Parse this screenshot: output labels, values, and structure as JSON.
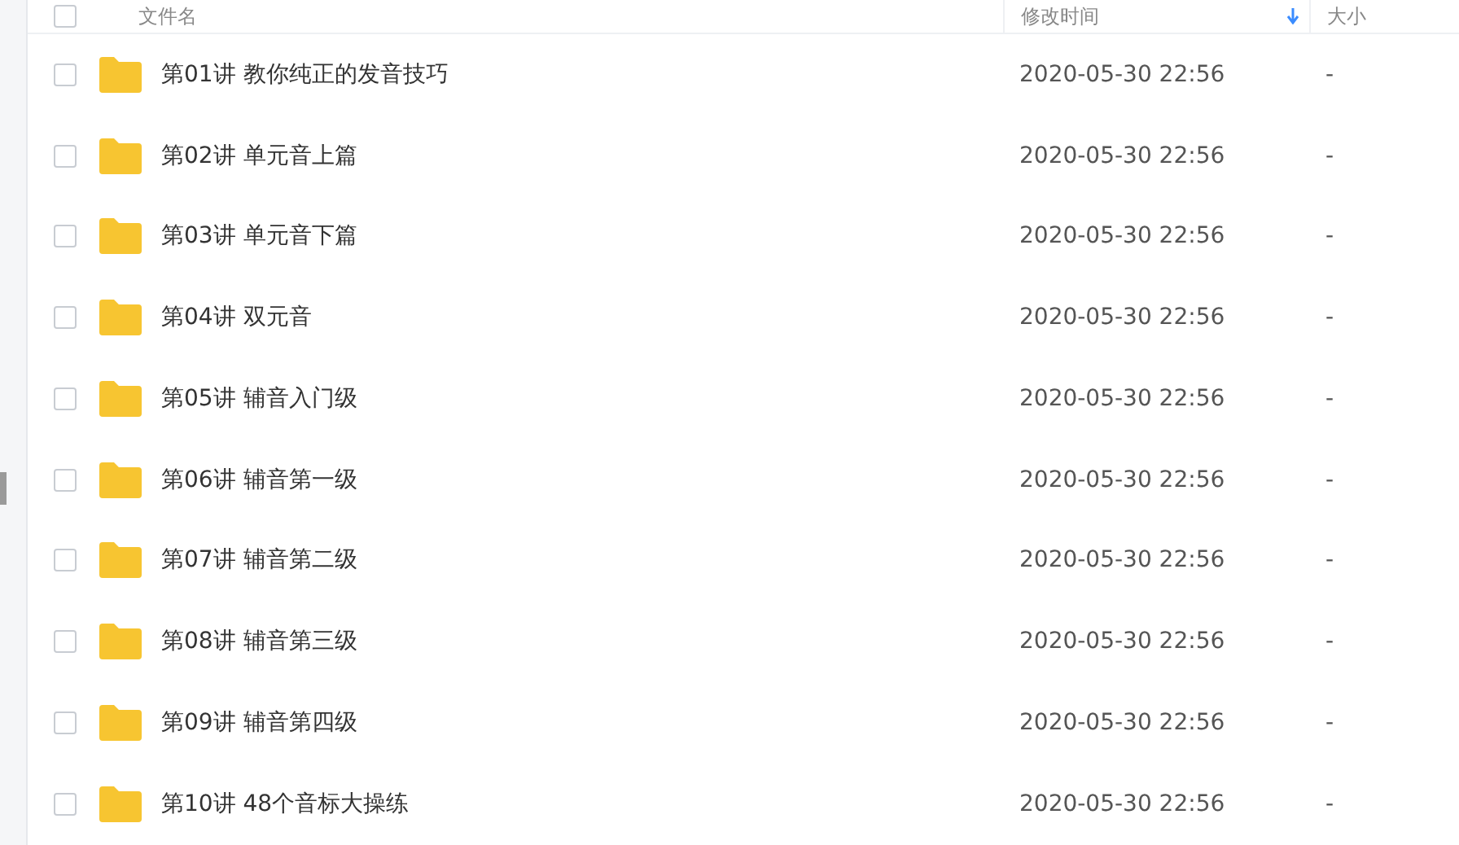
{
  "header": {
    "checked": false,
    "columns": [
      {
        "label": "文件名",
        "sorted": false
      },
      {
        "label": "修改时间",
        "sorted": true
      },
      {
        "label": "大小",
        "sorted": false
      }
    ]
  },
  "rows": [
    {
      "name": "第01讲 教你纯正的发音技巧",
      "modified": "2020-05-30 22:56",
      "size": "-",
      "checked": false
    },
    {
      "name": "第02讲 单元音上篇",
      "modified": "2020-05-30 22:56",
      "size": "-",
      "checked": false
    },
    {
      "name": "第03讲 单元音下篇",
      "modified": "2020-05-30 22:56",
      "size": "-",
      "checked": false
    },
    {
      "name": "第04讲 双元音",
      "modified": "2020-05-30 22:56",
      "size": "-",
      "checked": false
    },
    {
      "name": "第05讲 辅音入门级",
      "modified": "2020-05-30 22:56",
      "size": "-",
      "checked": false
    },
    {
      "name": "第06讲 辅音第一级",
      "modified": "2020-05-30 22:56",
      "size": "-",
      "checked": false
    },
    {
      "name": "第07讲 辅音第二级",
      "modified": "2020-05-30 22:56",
      "size": "-",
      "checked": false
    },
    {
      "name": "第08讲 辅音第三级",
      "modified": "2020-05-30 22:56",
      "size": "-",
      "checked": false
    },
    {
      "name": "第09讲 辅音第四级",
      "modified": "2020-05-30 22:56",
      "size": "-",
      "checked": false
    },
    {
      "name": "第10讲 48个音标大操练",
      "modified": "2020-05-30 22:56",
      "size": "-",
      "checked": false
    }
  ]
}
